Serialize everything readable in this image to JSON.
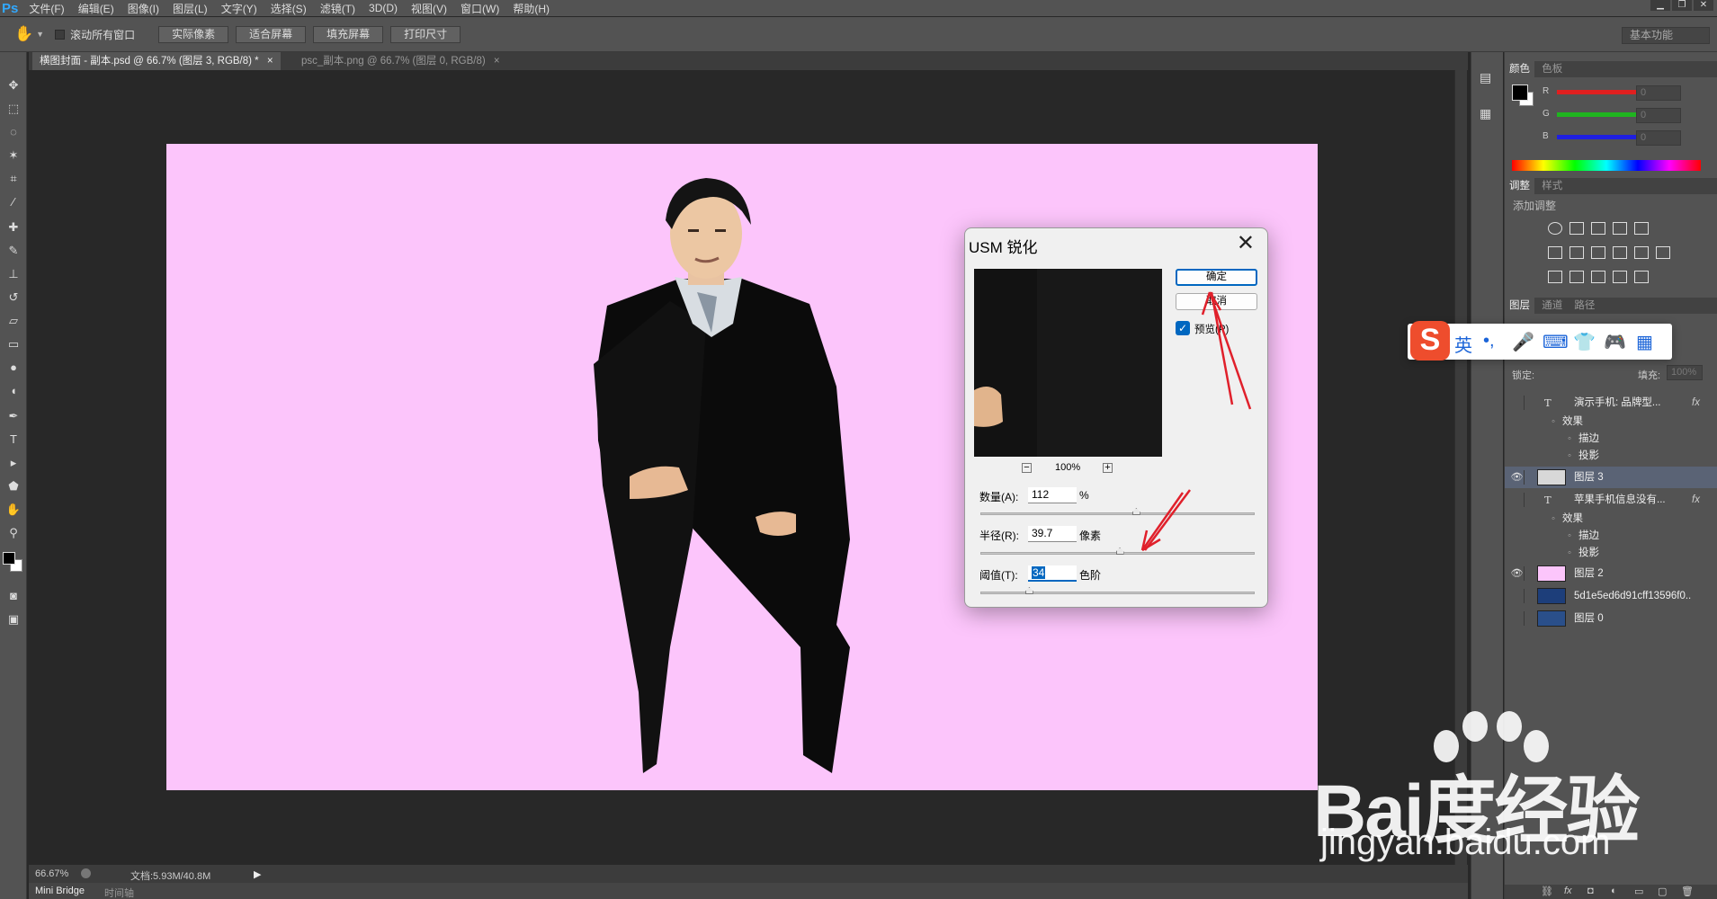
{
  "app": {
    "logo": "Ps",
    "menu": [
      "文件(F)",
      "编辑(E)",
      "图像(I)",
      "图层(L)",
      "文字(Y)",
      "选择(S)",
      "滤镜(T)",
      "3D(D)",
      "视图(V)",
      "窗口(W)",
      "帮助(H)"
    ],
    "window_controls": [
      "▁",
      "❐",
      "✕"
    ]
  },
  "options": {
    "scroll_all_label": "滚动所有窗口",
    "buttons": [
      "实际像素",
      "适合屏幕",
      "填充屏幕",
      "打印尺寸"
    ],
    "workspace": "基本功能"
  },
  "tabs": [
    {
      "label": "横图封面 - 副本.psd @ 66.7% (图层 3, RGB/8) *",
      "close": "×"
    },
    {
      "label": "psc_副本.png @ 66.7% (图层 0, RGB/8)",
      "close": "×"
    }
  ],
  "canvas": {
    "background": "#fcc5fb"
  },
  "status": {
    "zoom": "66.67%",
    "doc": "文档:5.93M/40.8M",
    "arrow": "▶"
  },
  "bottom_tabs": [
    "Mini Bridge",
    "时间轴"
  ],
  "color_panel": {
    "tabs": [
      "颜色",
      "色板"
    ],
    "channels": [
      {
        "label": "R",
        "value": "0",
        "color": "#e01f1f"
      },
      {
        "label": "G",
        "value": "0",
        "color": "#1fb41f"
      },
      {
        "label": "B",
        "value": "0",
        "color": "#1f1fe0"
      }
    ]
  },
  "adjust_panel": {
    "tabs": [
      "调整",
      "样式"
    ],
    "title": "添加调整"
  },
  "layers_panel": {
    "tabs": [
      "图层",
      "通道",
      "路径"
    ],
    "lock_label": "锁定:",
    "fill_label": "填充:",
    "fill_value": "100%",
    "layers": [
      {
        "type": "text",
        "name": "演示手机: 品牌型...",
        "fx": "fx",
        "visible": false,
        "effects": [
          "效果",
          "描边",
          "投影"
        ]
      },
      {
        "type": "image",
        "name": "图层 3",
        "visible": true,
        "selected": true,
        "thumb": "#d8d8d8"
      },
      {
        "type": "text",
        "name": "苹果手机信息没有...",
        "fx": "fx",
        "visible": false,
        "effects": [
          "效果",
          "描边",
          "投影"
        ]
      },
      {
        "type": "image",
        "name": "图层 2",
        "visible": true,
        "thumb": "#fcc5fb"
      },
      {
        "type": "image",
        "name": "5d1e5ed6d91cff13596f0...",
        "visible": false,
        "thumb": "#1d3e7a"
      },
      {
        "type": "image",
        "name": "图层 0",
        "visible": false,
        "thumb": "#2a4f8a"
      }
    ]
  },
  "dialog": {
    "title": "USM 锐化",
    "close": "✕",
    "ok": "确定",
    "cancel": "取消",
    "preview_label": "预览(P)",
    "preview_checked": true,
    "zoom": "100%",
    "zoom_out": "−",
    "zoom_in": "+",
    "amount": {
      "label": "数量(A):",
      "value": "112",
      "unit": "%",
      "slider": 0.57
    },
    "radius": {
      "label": "半径(R):",
      "value": "39.7",
      "unit": "像素",
      "slider": 0.51
    },
    "threshold": {
      "label": "阈值(T):",
      "value": "34",
      "unit": "色阶",
      "slider": 0.18
    }
  },
  "ime": {
    "logo": "S",
    "items": [
      "英",
      "•,",
      "🎤",
      "⌨",
      "👕",
      "🎮",
      "▦"
    ]
  },
  "watermark": {
    "brand": "Bai度经验",
    "url": "jingyan.baidu.com"
  }
}
